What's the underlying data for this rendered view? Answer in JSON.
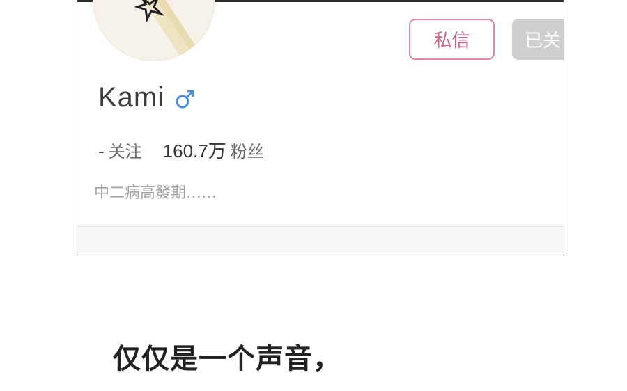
{
  "profile": {
    "buttons": {
      "message_label": "私信",
      "followed_label": "已关"
    },
    "username": "Kami",
    "gender_icon": "male-symbol-icon",
    "stats": {
      "following_count": "-",
      "following_label": "关注",
      "followers_count": "160.7万",
      "followers_label": "粉丝"
    },
    "bio": "中二病高發期……"
  },
  "caption": "仅仅是一个声音，",
  "colors": {
    "message_border": "#de8aa3",
    "message_text": "#cc6488",
    "followed_bg": "#cfcfcf",
    "gender_icon": "#4a90d9"
  }
}
